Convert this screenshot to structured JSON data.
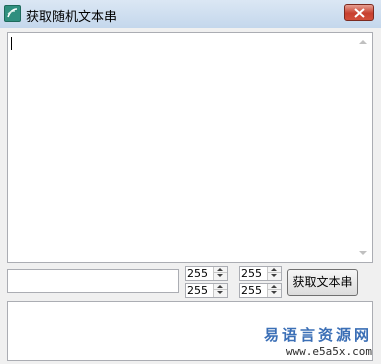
{
  "window": {
    "title": "获取随机文本串"
  },
  "spinners": [
    {
      "value": "255"
    },
    {
      "value": "255"
    },
    {
      "value": "255"
    },
    {
      "value": "255"
    }
  ],
  "buttons": {
    "get_text": "获取文本串"
  },
  "watermark": {
    "title": "易语言资源网",
    "url": "www.e5a5x.com"
  },
  "icons": {
    "app": "app-icon",
    "close": "close-icon"
  },
  "colors": {
    "close_button": "#c7402f",
    "watermark_title": "#3b6fb6"
  }
}
